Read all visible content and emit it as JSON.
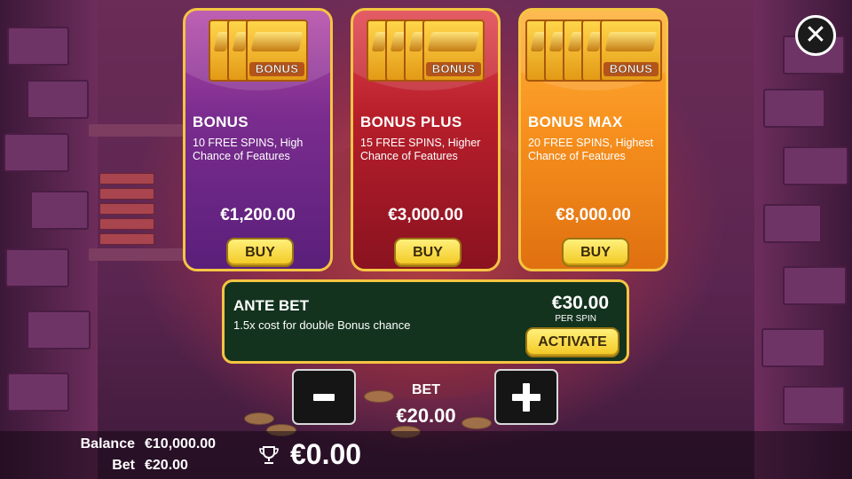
{
  "close_icon": "close-x-icon",
  "cards": [
    {
      "title": "BONUS",
      "description": "10 FREE SPINS, High Chance of Features",
      "price": "€1,200.00",
      "buy_label": "BUY",
      "ticket_label": "BONUS",
      "ticket_count": 3,
      "theme": "#7b2d8f"
    },
    {
      "title": "BONUS PLUS",
      "description": "15 FREE SPINS, Higher Chance of Features",
      "price": "€3,000.00",
      "buy_label": "BUY",
      "ticket_label": "BONUS",
      "ticket_count": 4,
      "theme": "#b81f2b"
    },
    {
      "title": "BONUS MAX",
      "description": "20 FREE SPINS, Highest Chance of Features",
      "price": "€8,000.00",
      "buy_label": "BUY",
      "ticket_label": "BONUS",
      "ticket_count": 5,
      "theme": "#f7911e"
    }
  ],
  "ante": {
    "title": "ANTE BET",
    "description": "1.5x cost for double Bonus chance",
    "price": "€30.00",
    "per_spin": "PER SPIN",
    "activate_label": "ACTIVATE"
  },
  "bet": {
    "label": "BET",
    "value": "€20.00",
    "minus_icon": "minus-icon",
    "plus_icon": "plus-icon"
  },
  "footer": {
    "balance_label": "Balance",
    "balance_value": "€10,000.00",
    "bet_label": "Bet",
    "bet_value": "€20.00",
    "win_icon": "trophy-icon",
    "win_value": "€0.00"
  },
  "colors": {
    "card_border": "#f5c542",
    "button_yellow": "#f3c822",
    "ante_bg": "#13331e"
  }
}
